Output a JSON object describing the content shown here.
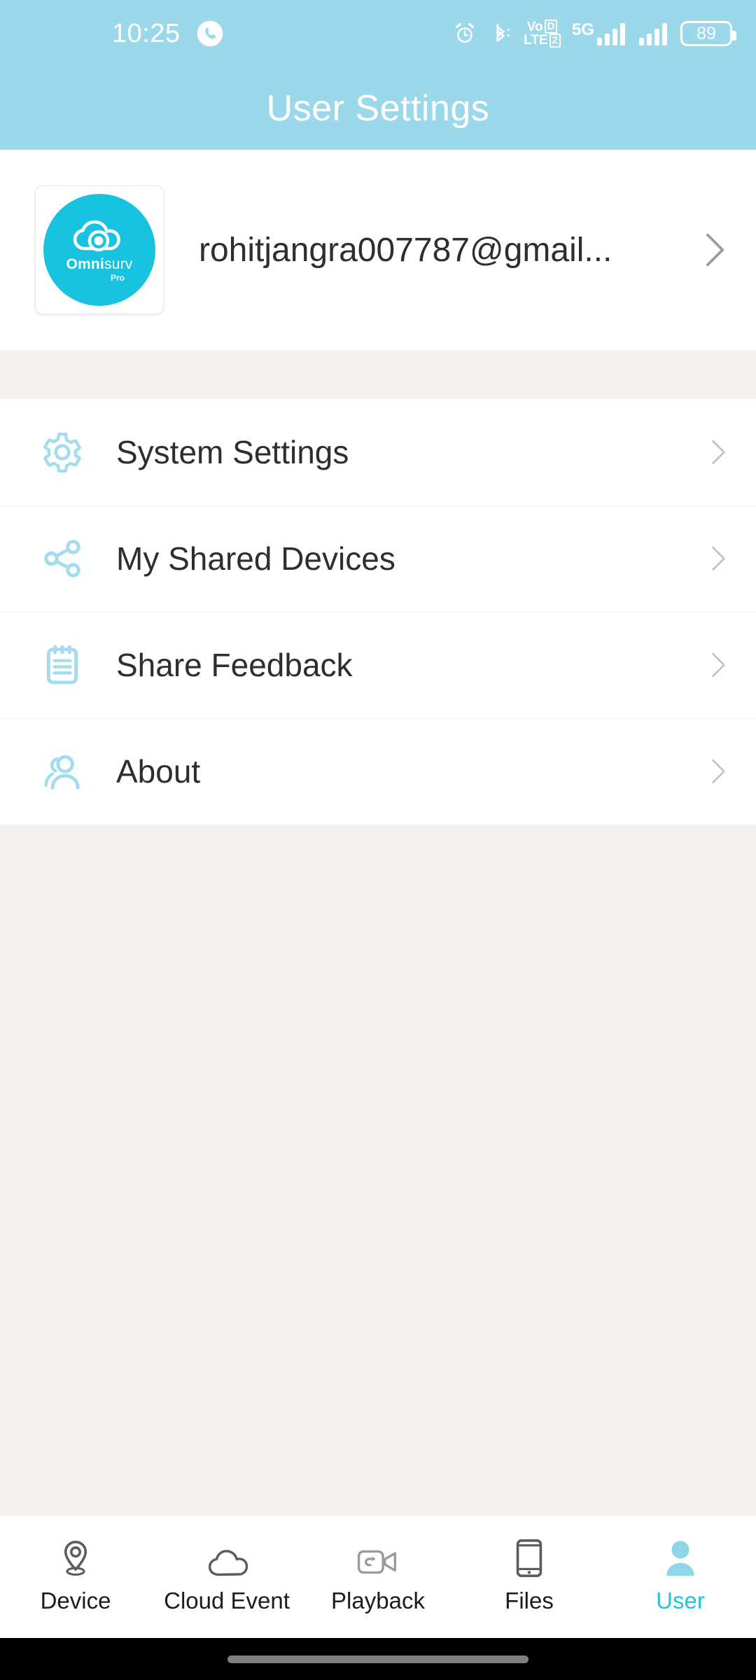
{
  "status_bar": {
    "time": "10:25",
    "phone_icon": "phone-icon",
    "alarm_icon": "alarm-clock-icon",
    "bluetooth_icon": "bluetooth-icon",
    "volte_label": "VoLTE",
    "volte_top": "Vo",
    "volte_bottom": "LTE",
    "volte_sim_top": "D",
    "volte_sim_bottom": "2",
    "network_label": "5G",
    "signal_icon": "signal-bars-icon",
    "signal2_icon": "signal-bars-icon",
    "battery_level": "89"
  },
  "header": {
    "title": "User Settings"
  },
  "profile": {
    "logo_name_bold": "Omni",
    "logo_name_light": "surv",
    "logo_tier": "Pro",
    "logo_icon": "cloud-camera-logo",
    "email": "rohitjangra007787@gmail...",
    "chevron_icon": "chevron-right-icon"
  },
  "menu": {
    "items": [
      {
        "label": "System Settings",
        "icon": "gear-icon",
        "name": "system-settings"
      },
      {
        "label": "My Shared Devices",
        "icon": "share-icon",
        "name": "my-shared-devices"
      },
      {
        "label": "Share Feedback",
        "icon": "notepad-icon",
        "name": "share-feedback"
      },
      {
        "label": "About",
        "icon": "people-icon",
        "name": "about"
      }
    ]
  },
  "tabbar": {
    "items": [
      {
        "label": "Device",
        "icon": "location-pin-icon",
        "active": false
      },
      {
        "label": "Cloud Event",
        "icon": "cloud-icon",
        "active": false
      },
      {
        "label": "Playback",
        "icon": "video-replay-icon",
        "active": false
      },
      {
        "label": "Files",
        "icon": "phone-device-icon",
        "active": false
      },
      {
        "label": "User",
        "icon": "user-icon",
        "active": true
      }
    ]
  },
  "colors": {
    "header_blue": "#9bd8ea",
    "accent_cyan": "#22c3e0",
    "logo_cyan": "#18c3e0",
    "icon_blue": "#a3dcec",
    "page_background": "#f3f0ef",
    "text_dark": "#2e2e2e"
  }
}
